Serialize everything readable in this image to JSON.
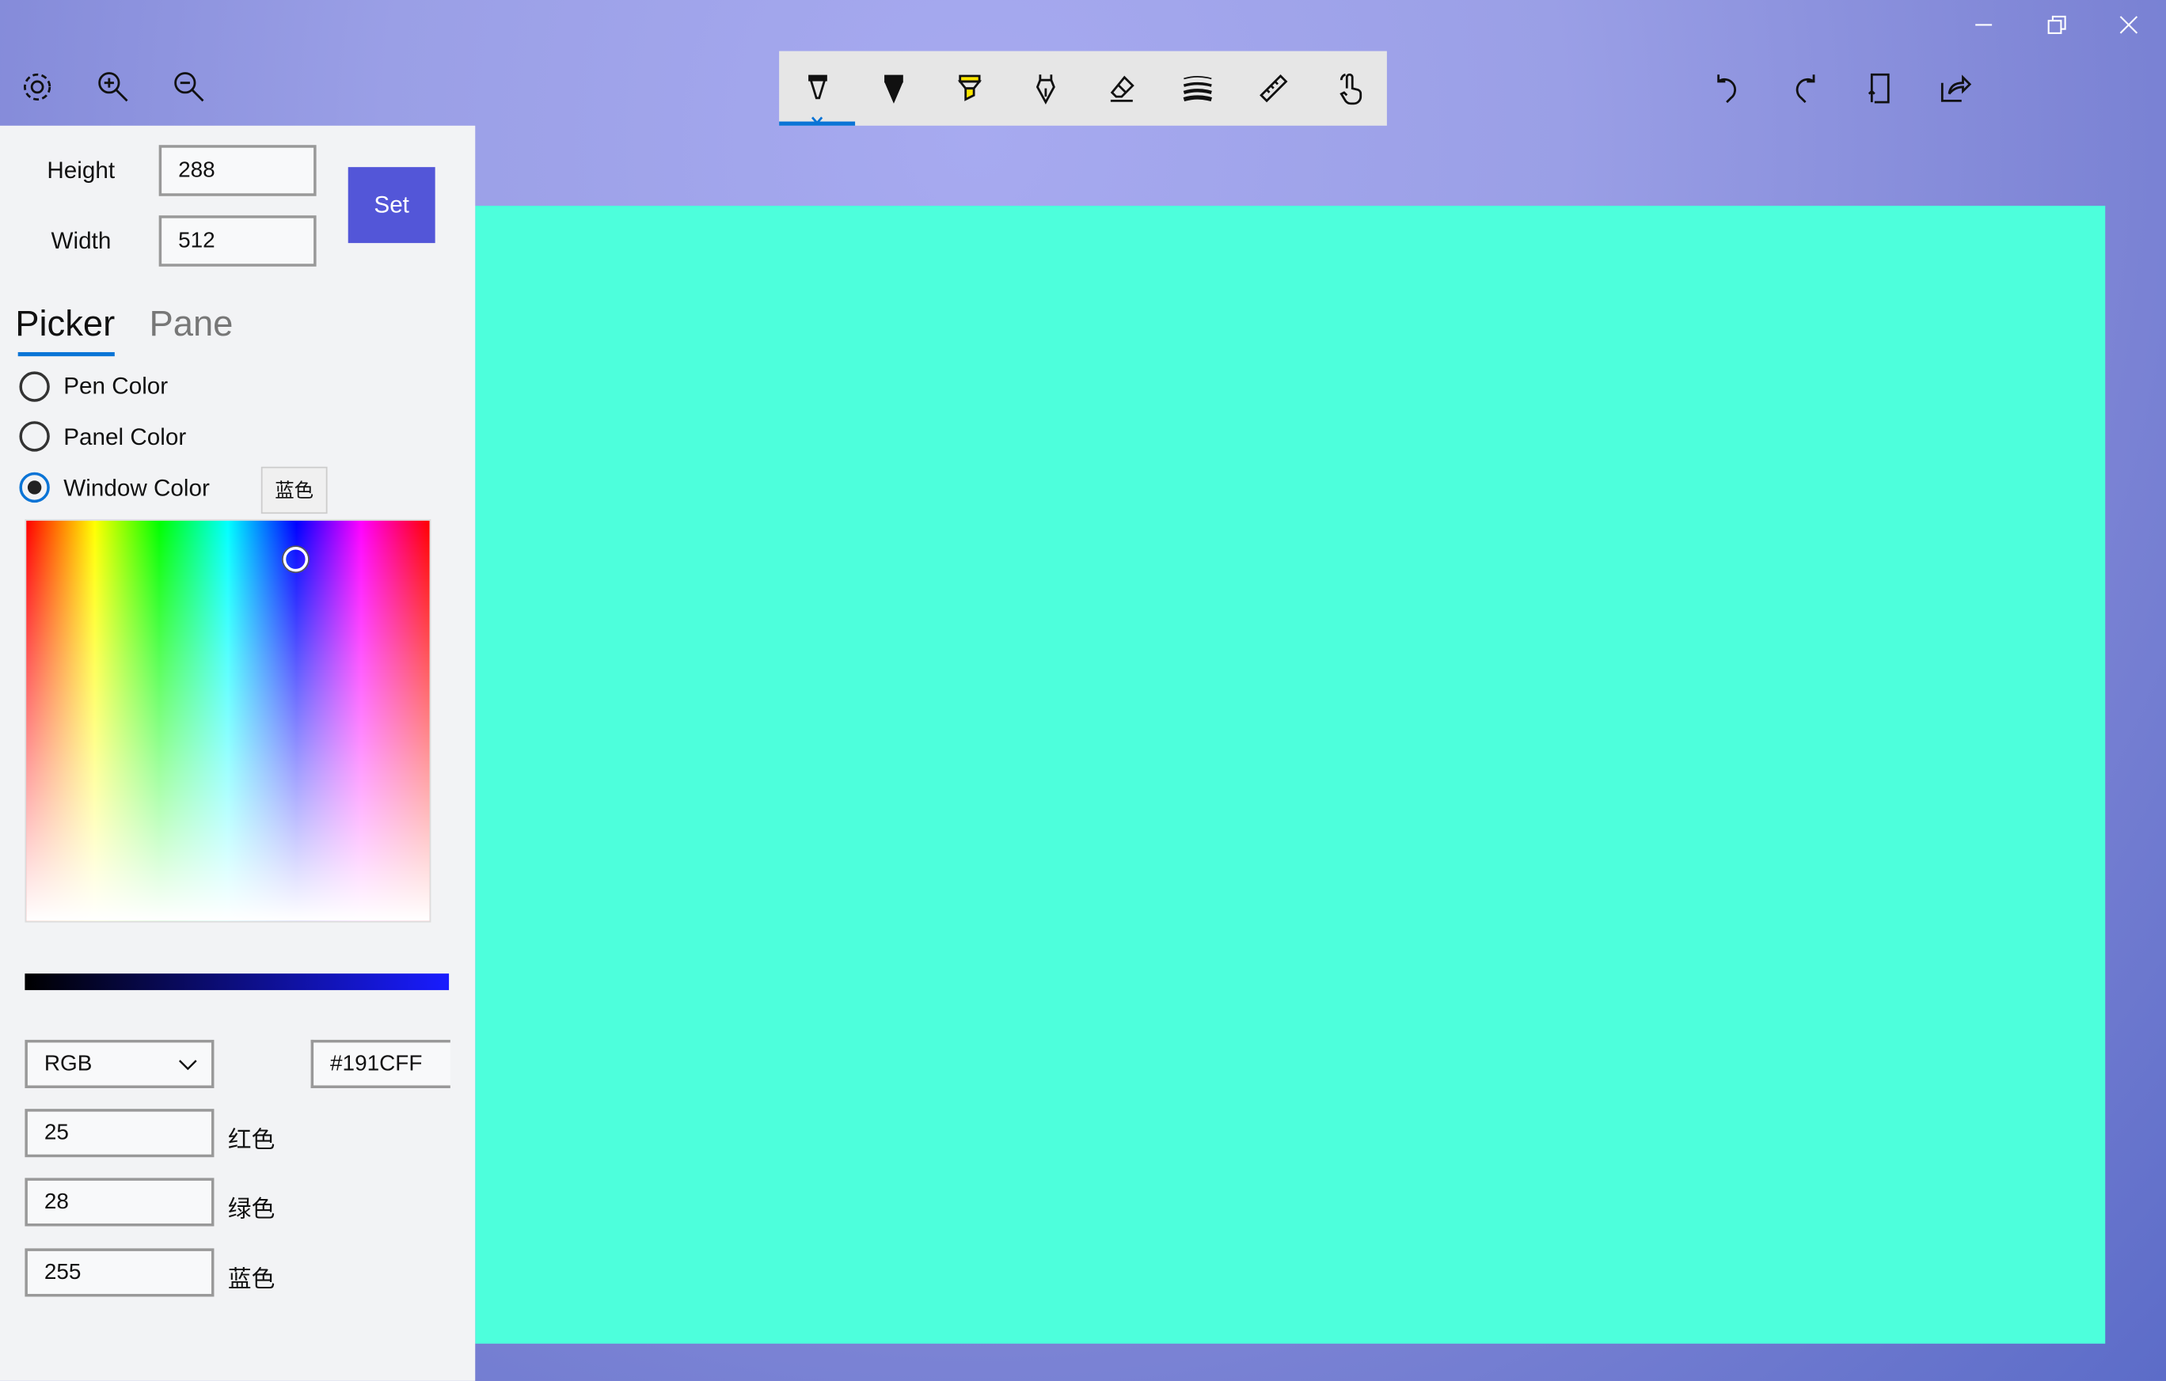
{
  "window": {
    "controls": [
      "minimize",
      "restore",
      "close"
    ]
  },
  "top_left_icons": [
    "gear-icon",
    "zoom-in-icon",
    "zoom-out-icon"
  ],
  "toolbar": {
    "tools": [
      "ballpoint-pen",
      "pencil",
      "highlighter",
      "calligraphy-pen",
      "eraser",
      "stroke-thickness",
      "ruler",
      "touch-writing"
    ],
    "selected": "ballpoint-pen",
    "accent": "#0a74d6"
  },
  "actions": [
    "undo",
    "redo",
    "crop",
    "share"
  ],
  "size": {
    "height_label": "Height",
    "height_value": "288",
    "width_label": "Width",
    "width_value": "512",
    "set_label": "Set",
    "set_color": "#5356d8"
  },
  "tabs": [
    {
      "label": "Picker",
      "active": true
    },
    {
      "label": "Pane",
      "active": false
    }
  ],
  "targets": [
    {
      "label": "Pen Color",
      "checked": false
    },
    {
      "label": "Panel Color",
      "checked": false
    },
    {
      "label": "Window Color",
      "checked": true
    }
  ],
  "color_name_button": "蓝色",
  "picker": {
    "mode": "RGB",
    "hex": "#191CFF",
    "channels": [
      {
        "value": "25",
        "label": "红色"
      },
      {
        "value": "28",
        "label": "绿色"
      },
      {
        "value": "255",
        "label": "蓝色"
      }
    ]
  },
  "canvas": {
    "color": "#4dffdc"
  }
}
